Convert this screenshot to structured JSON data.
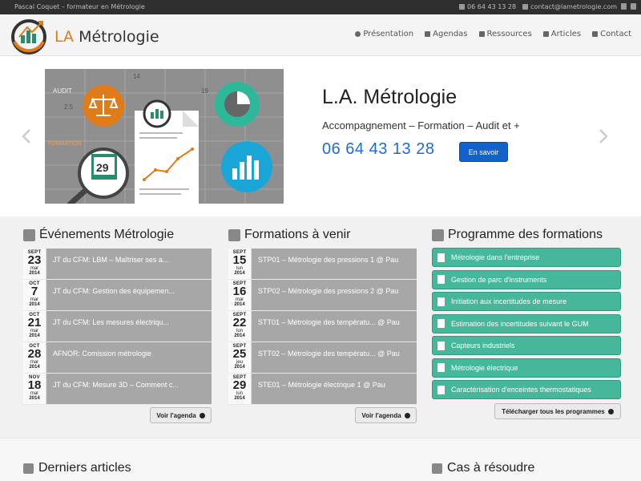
{
  "topbar": {
    "tagline": "Pascal Coquet – formateur en Métrologie",
    "phone": "06 64 43 13 28",
    "email": "contact@lametrologie.com"
  },
  "header": {
    "logo_prefix": "LA",
    "logo_name": "Métrologie",
    "nav": [
      {
        "label": "Présentation",
        "icon": "info-icon"
      },
      {
        "label": "Agendas",
        "icon": "calendar-icon"
      },
      {
        "label": "Ressources",
        "icon": "briefcase-icon"
      },
      {
        "label": "Articles",
        "icon": "edit-icon"
      },
      {
        "label": "Contact",
        "icon": "envelope-icon"
      }
    ]
  },
  "hero": {
    "title": "L.A. Métrologie",
    "subtitle": "Accompagnement – Formation – Audit et +",
    "phone": "06 64 43 13 28",
    "button": "En savoir",
    "image_labels": {
      "audit": "AUDIT",
      "formation": "FORMATION",
      "n14": "14",
      "n19": "19",
      "n25": "2.5",
      "day": "29"
    }
  },
  "events": {
    "title": "Événements Métrologie",
    "items": [
      {
        "month": "SEPT",
        "day": "23",
        "weekday": "mar",
        "year": "2014",
        "text": "JT du CFM: LBM – Maîtriser ses a..."
      },
      {
        "month": "OCT",
        "day": "7",
        "weekday": "mar",
        "year": "2014",
        "text": "JT du CFM: Gestion des équipemen..."
      },
      {
        "month": "OCT",
        "day": "21",
        "weekday": "mar",
        "year": "2014",
        "text": "JT du CFM: Les mesures électriqu..."
      },
      {
        "month": "OCT",
        "day": "28",
        "weekday": "mar",
        "year": "2014",
        "text": "AFNOR: Comission métrologie"
      },
      {
        "month": "NOV",
        "day": "18",
        "weekday": "mar",
        "year": "2014",
        "text": "JT du CFM: Mesure 3D – Comment c..."
      }
    ],
    "more": "Voir l'agenda"
  },
  "formations": {
    "title": "Formations à venir",
    "items": [
      {
        "month": "SEPT",
        "day": "15",
        "weekday": "lun",
        "year": "2014",
        "text": "STP01 – Métrologie des pressions 1 @ Pau"
      },
      {
        "month": "SEPT",
        "day": "16",
        "weekday": "mar",
        "year": "2014",
        "text": "STP02 – Métrologie des pressions 2 @ Pau"
      },
      {
        "month": "SEPT",
        "day": "22",
        "weekday": "lun",
        "year": "2014",
        "text": "STT01 – Métrologie des températu... @ Pau"
      },
      {
        "month": "SEPT",
        "day": "25",
        "weekday": "jeu",
        "year": "2014",
        "text": "STT02 – Métrologie des températu... @ Pau"
      },
      {
        "month": "SEPT",
        "day": "29",
        "weekday": "lun",
        "year": "2014",
        "text": "STE01 – Métrologie électrique 1 @ Pau"
      }
    ],
    "more": "Voir l'agenda"
  },
  "programme": {
    "title": "Programme des formations",
    "items": [
      "Métrologie dans l'entreprise",
      "Gestion de parc d'instruments",
      "Initiation aux incertitudes de mesure",
      "Estimation des incertitudes suivant le GUM",
      "Capteurs industriels",
      "Métrologie électrique",
      "Caractérisation d'enceintes thermostatiques"
    ],
    "more": "Télécharger tous les programmes"
  },
  "bottom": {
    "articles": "Derniers articles",
    "cases": "Cas à résoudre"
  },
  "colors": {
    "accent": "#1162c9",
    "phone": "#1e6bd6",
    "teal": "#46b79a",
    "orange": "#e07b1a",
    "event_bg": "#a7a7a7"
  }
}
